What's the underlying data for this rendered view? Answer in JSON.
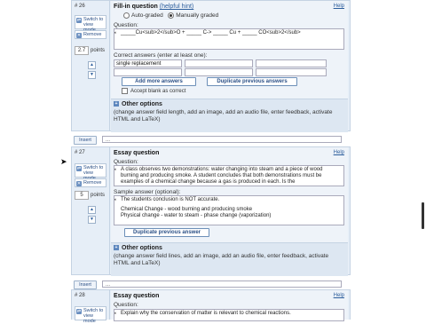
{
  "q26": {
    "number_label": "# 26",
    "title": "Fill-in question",
    "help_link": "(helpful hint)",
    "help": "Help",
    "switch_label": "Switch to view mode",
    "remove_label": "Remove",
    "points_value": "2.7",
    "points_label": "points",
    "grading": {
      "auto": "Auto-graded",
      "manual": "Manually graded"
    },
    "question_label": "Question:",
    "question_text": "_____Cu<sub>2</sub>O + _____ C-> _____ Cu + _____ CO<sub>2</sub>",
    "answers_label": "Correct answers (enter at least one):",
    "answer1": "single replacement",
    "add_more": "Add more answers",
    "duplicate": "Duplicate previous answers",
    "accept_blank": "Accept blank as correct",
    "other_title": "Other options",
    "other_desc": "(change answer field length, add an image, add an audio file, enter feedback, activate HTML and LaTeX)"
  },
  "insert": {
    "button": "Insert",
    "select": "..."
  },
  "q27": {
    "number_label": "# 27",
    "title": "Essay question",
    "help": "Help",
    "switch_label": "Switch to view mode",
    "remove_label": "Remove",
    "points_value": "5",
    "points_label": "points",
    "question_label": "Question:",
    "question_text": "A class observes two demonstrations: water changing into steam and a piece of wood burning and producing smoke. A student concludes that both demonstrations must be examples of a chemical change because a gas is produced in each. Is the",
    "sample_label": "Sample answer (optional):",
    "sample_line1": "The students conclusion is NOT accurate.",
    "sample_line2": "Chemical Change - wood burning and producing smoke",
    "sample_line3": "Physical change - water to steam - phase change (vaporization)",
    "duplicate": "Duplicate previous answer",
    "other_title": "Other options",
    "other_desc": "(change answer field lines, add an image, add an audio file, enter feedback, activate HTML and LaTeX)"
  },
  "insert2": {
    "button": "Insert",
    "select": "..."
  },
  "q28": {
    "number_label": "# 28",
    "title": "Essay question",
    "help": "Help",
    "switch_label": "Switch to view mode",
    "question_label": "Question:",
    "question_text": "Explain why the conservation of matter is relevant to chemical reactions."
  },
  "colors": {
    "panel": "#e6eef7",
    "accent": "#2b5d9c",
    "border": "#c5d3e3"
  }
}
